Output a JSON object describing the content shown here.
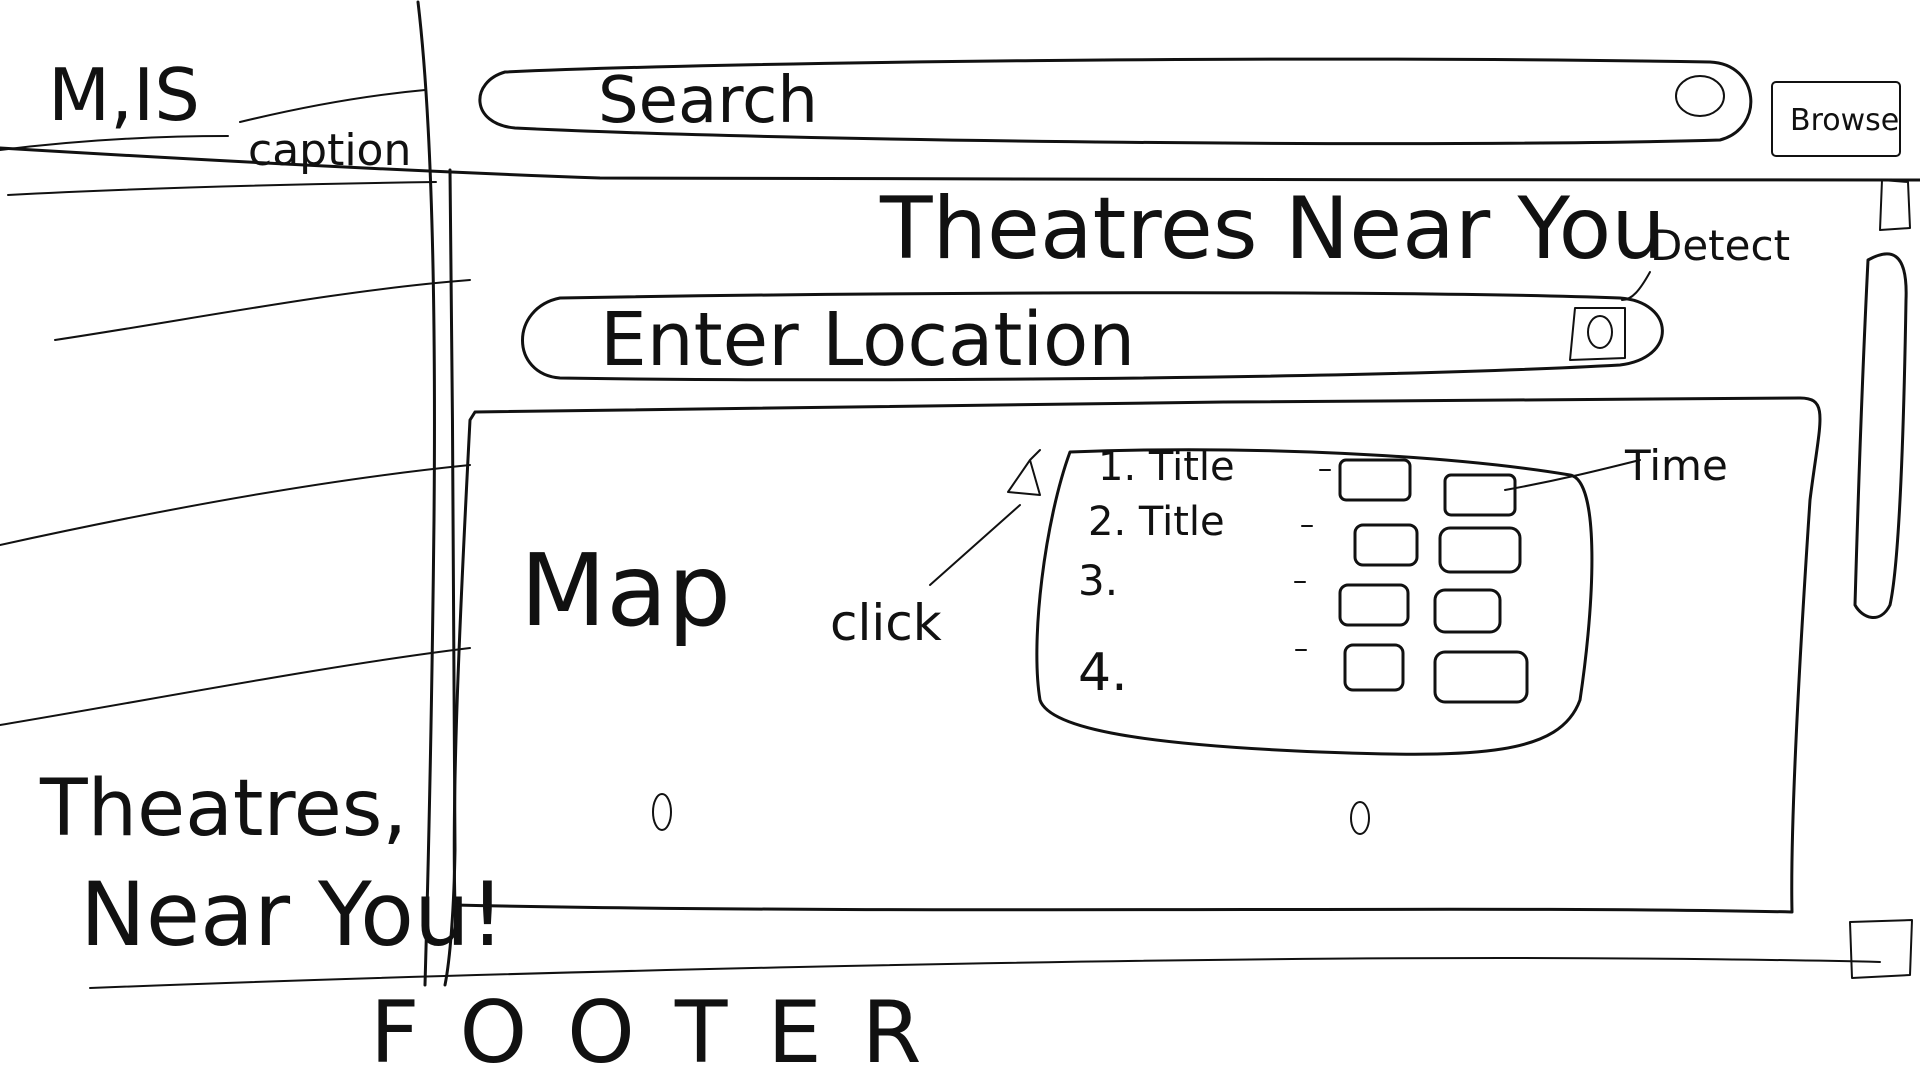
{
  "sidebar": {
    "logo": "M,IS",
    "caption": "caption",
    "tagline_line1": "Theatres,",
    "tagline_line2": "Near You!"
  },
  "header": {
    "search_label": "Search",
    "browse_label": "Browse"
  },
  "main": {
    "heading": "Theatres Near You",
    "location_placeholder": "Enter Location",
    "detect_label": "Detect",
    "map_label": "Map",
    "click_annotation": "click",
    "time_annotation": "Time",
    "list": [
      {
        "label": "1. Title"
      },
      {
        "label": "2. Title"
      },
      {
        "label": "3."
      },
      {
        "label": "4."
      }
    ]
  },
  "footer": {
    "label": "FOOTER"
  }
}
